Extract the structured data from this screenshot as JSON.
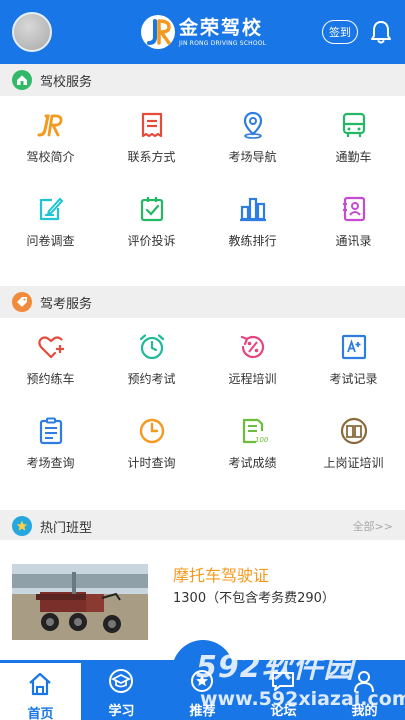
{
  "header": {
    "brand_cn": "金荣驾校",
    "brand_en": "JIN RONG DRIVING SCHOOL",
    "checkin_label": "签到"
  },
  "sections": {
    "school_services": {
      "title": "驾校服务",
      "items": [
        {
          "label": "驾校简介",
          "icon": "jr-logo-icon"
        },
        {
          "label": "联系方式",
          "icon": "contact-card-icon"
        },
        {
          "label": "考场导航",
          "icon": "location-pin-icon"
        },
        {
          "label": "通勤车",
          "icon": "bus-icon"
        },
        {
          "label": "问卷调查",
          "icon": "survey-edit-icon"
        },
        {
          "label": "评价投诉",
          "icon": "feedback-check-icon"
        },
        {
          "label": "教练排行",
          "icon": "ranking-bars-icon"
        },
        {
          "label": "通讯录",
          "icon": "address-book-icon"
        }
      ]
    },
    "exam_services": {
      "title": "驾考服务",
      "items": [
        {
          "label": "预约练车",
          "icon": "heart-plus-icon"
        },
        {
          "label": "预约考试",
          "icon": "alarm-clock-icon"
        },
        {
          "label": "远程培训",
          "icon": "percent-refresh-icon"
        },
        {
          "label": "考试记录",
          "icon": "record-grade-icon"
        },
        {
          "label": "考场查询",
          "icon": "clipboard-list-icon"
        },
        {
          "label": "计时查询",
          "icon": "clock-icon"
        },
        {
          "label": "考试成绩",
          "icon": "score-sheet-icon"
        },
        {
          "label": "上岗证培训",
          "icon": "certificate-book-icon"
        }
      ]
    },
    "hot_courses": {
      "title": "热门班型",
      "more_label": "全部>>",
      "course": {
        "title": "摩托车驾驶证",
        "price": "1300（不包含考务费290）"
      }
    }
  },
  "tabbar": {
    "items": [
      {
        "label": "首页",
        "icon": "home-icon",
        "active": true
      },
      {
        "label": "学习",
        "icon": "graduation-cap-icon",
        "active": false
      },
      {
        "label": "推荐",
        "icon": "recommend-icon",
        "active": false
      },
      {
        "label": "论坛",
        "icon": "forum-icon",
        "active": false
      },
      {
        "label": "我的",
        "icon": "user-icon",
        "active": false
      }
    ]
  },
  "watermark": {
    "brand": "592软件园",
    "url": "www.592xiazai.com"
  },
  "colors": {
    "primary": "#1976e6",
    "accent_orange": "#f39a1e",
    "section_bg": "#efefef"
  }
}
